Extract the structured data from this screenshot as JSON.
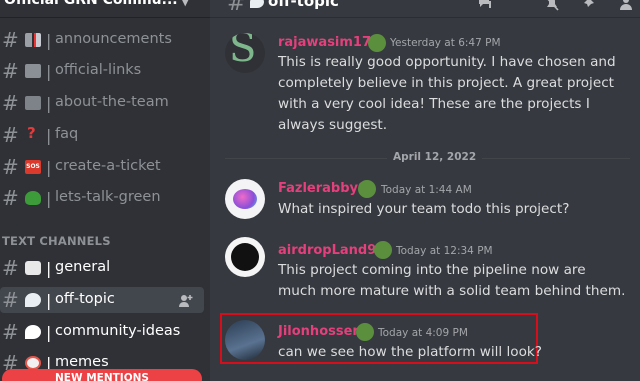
{
  "server": {
    "name": "Official GRN Commu..."
  },
  "channels": [
    {
      "label": "announcements",
      "emoji_color": "#c9cdd3"
    },
    {
      "label": "official-links",
      "emoji_color": "#9aa0a6"
    },
    {
      "label": "about-the-team",
      "emoji_color": "#9aa0a6"
    },
    {
      "label": "faq",
      "emoji_color": "#e03c3c"
    },
    {
      "label": "create-a-ticket",
      "emoji_color": "#d93a2b"
    },
    {
      "label": "lets-talk-green",
      "emoji_color": "#3e9b3a"
    }
  ],
  "category": {
    "label": "TEXT CHANNELS"
  },
  "text_channels": [
    {
      "label": "general",
      "emoji_color": "#e8e8e8"
    },
    {
      "label": "off-topic",
      "emoji_color": "#e9eef2"
    },
    {
      "label": "community-ideas",
      "emoji_color": "#ffffff"
    },
    {
      "label": "memes",
      "emoji_color": "#e6564b"
    }
  ],
  "new_mentions": "NEW MENTIONS",
  "topbar": {
    "channel": "off-topic"
  },
  "messages": [
    {
      "author": "rajawasim176",
      "timestamp": "Yesterday at 6:47 PM",
      "lines": [
        "This is really good opportunity. I have chosen and",
        "completely believe in this project. A great project",
        "with a very cool idea! These are the projects I",
        "always suggest."
      ]
    },
    {
      "author": "Fazlerabby0",
      "timestamp": "Today at 1:44 AM",
      "lines": [
        "What inspired your team todo this project?"
      ]
    },
    {
      "author": "airdropLand98",
      "timestamp": "Today at 12:34 PM",
      "lines": [
        "This project coming into the pipeline now are",
        "much more mature with a solid team behind them."
      ]
    },
    {
      "author": "Jilonhossen",
      "timestamp": "Today at 4:09 PM",
      "lines": [
        "can we see how the platform will look?"
      ]
    }
  ],
  "date_divider": "April 12, 2022",
  "colors": {
    "accent_username": "#e63f7d",
    "highlight": "#d60d1a",
    "mention_bar": "#ed4245"
  }
}
